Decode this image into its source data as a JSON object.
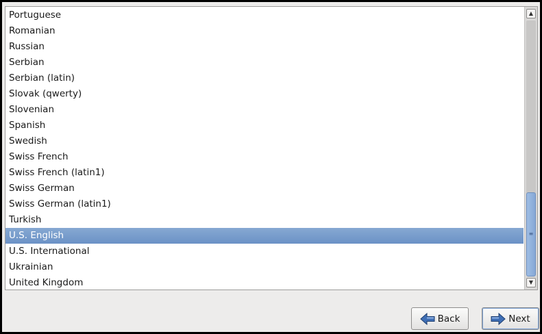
{
  "keyboard_list": {
    "items": [
      "Portuguese",
      "Romanian",
      "Russian",
      "Serbian",
      "Serbian (latin)",
      "Slovak (qwerty)",
      "Slovenian",
      "Spanish",
      "Swedish",
      "Swiss French",
      "Swiss French (latin1)",
      "Swiss German",
      "Swiss German (latin1)",
      "Turkish",
      "U.S. English",
      "U.S. International",
      "Ukrainian",
      "United Kingdom"
    ],
    "selected": "U.S. English"
  },
  "scrollbar": {
    "up_icon": "▲",
    "down_icon": "▼",
    "grip_icon": "≡",
    "position_fraction": 1.0
  },
  "buttons": {
    "back_label": "Back",
    "next_label": "Next",
    "back_icon": "arrow-left-icon",
    "next_icon": "arrow-right-icon"
  },
  "colors": {
    "selection": "#6b92c6",
    "arrow_icon": "#3f6fb5"
  }
}
